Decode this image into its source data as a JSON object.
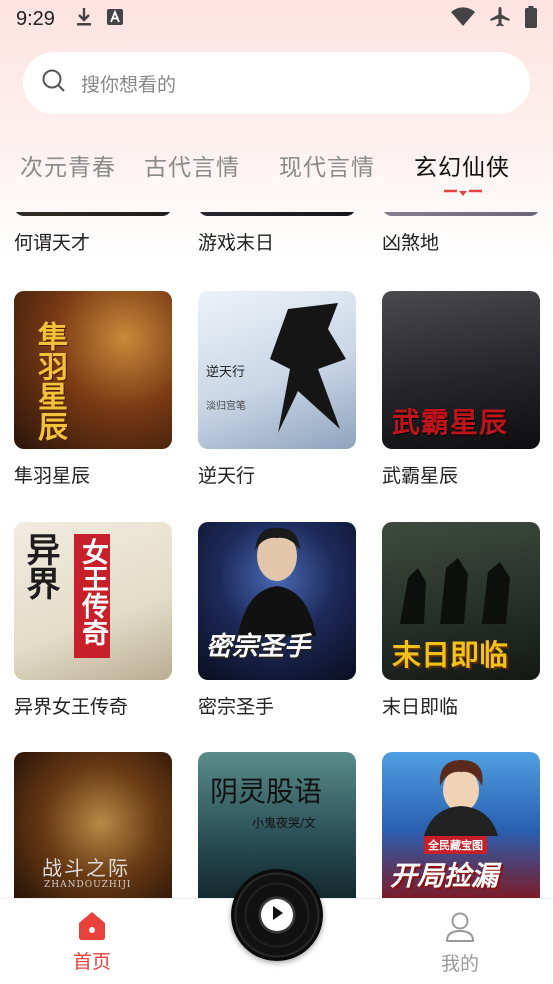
{
  "status_bar": {
    "time": "9:29",
    "left_icons": [
      "download-icon",
      "text-a-icon"
    ],
    "right_icons": [
      "wifi-icon",
      "airplane-icon",
      "battery-icon"
    ]
  },
  "search": {
    "placeholder": "搜你想看的"
  },
  "tabs": [
    {
      "label": "二次元青春",
      "display": "次元青春",
      "active": false
    },
    {
      "label": "古代言情",
      "active": false
    },
    {
      "label": "现代言情",
      "active": false
    },
    {
      "label": "玄幻仙侠",
      "active": true
    }
  ],
  "books": [
    {
      "title": "何谓天才"
    },
    {
      "title": "游戏末日"
    },
    {
      "title": "凶煞地"
    },
    {
      "title": "隼羽星辰",
      "cover_text": "隼羽星辰"
    },
    {
      "title": "逆天行",
      "cover_text": "逆天行",
      "cover_subtext": "淡归宫笔"
    },
    {
      "title": "武霸星辰",
      "cover_text": "武霸星辰"
    },
    {
      "title": "异界女王传奇",
      "cover_text": "女王传奇",
      "cover_subtext": "异界"
    },
    {
      "title": "密宗圣手",
      "cover_text": "密宗圣手"
    },
    {
      "title": "末日即临",
      "cover_text": "末日即临"
    },
    {
      "title": "",
      "cover_text": "战斗之际",
      "cover_subtext": "ZHANDOUZHIJI"
    },
    {
      "title": "",
      "cover_text": "阴灵股语",
      "cover_subtext": "小鬼夜哭/文"
    },
    {
      "title": "",
      "cover_text": "开局捡漏",
      "cover_subtext": "全民藏宝图"
    }
  ],
  "bottom_nav": {
    "home_label": "首页",
    "mine_label": "我的"
  },
  "colors": {
    "accent": "#e8403a",
    "inactive": "#9a9a9a"
  }
}
